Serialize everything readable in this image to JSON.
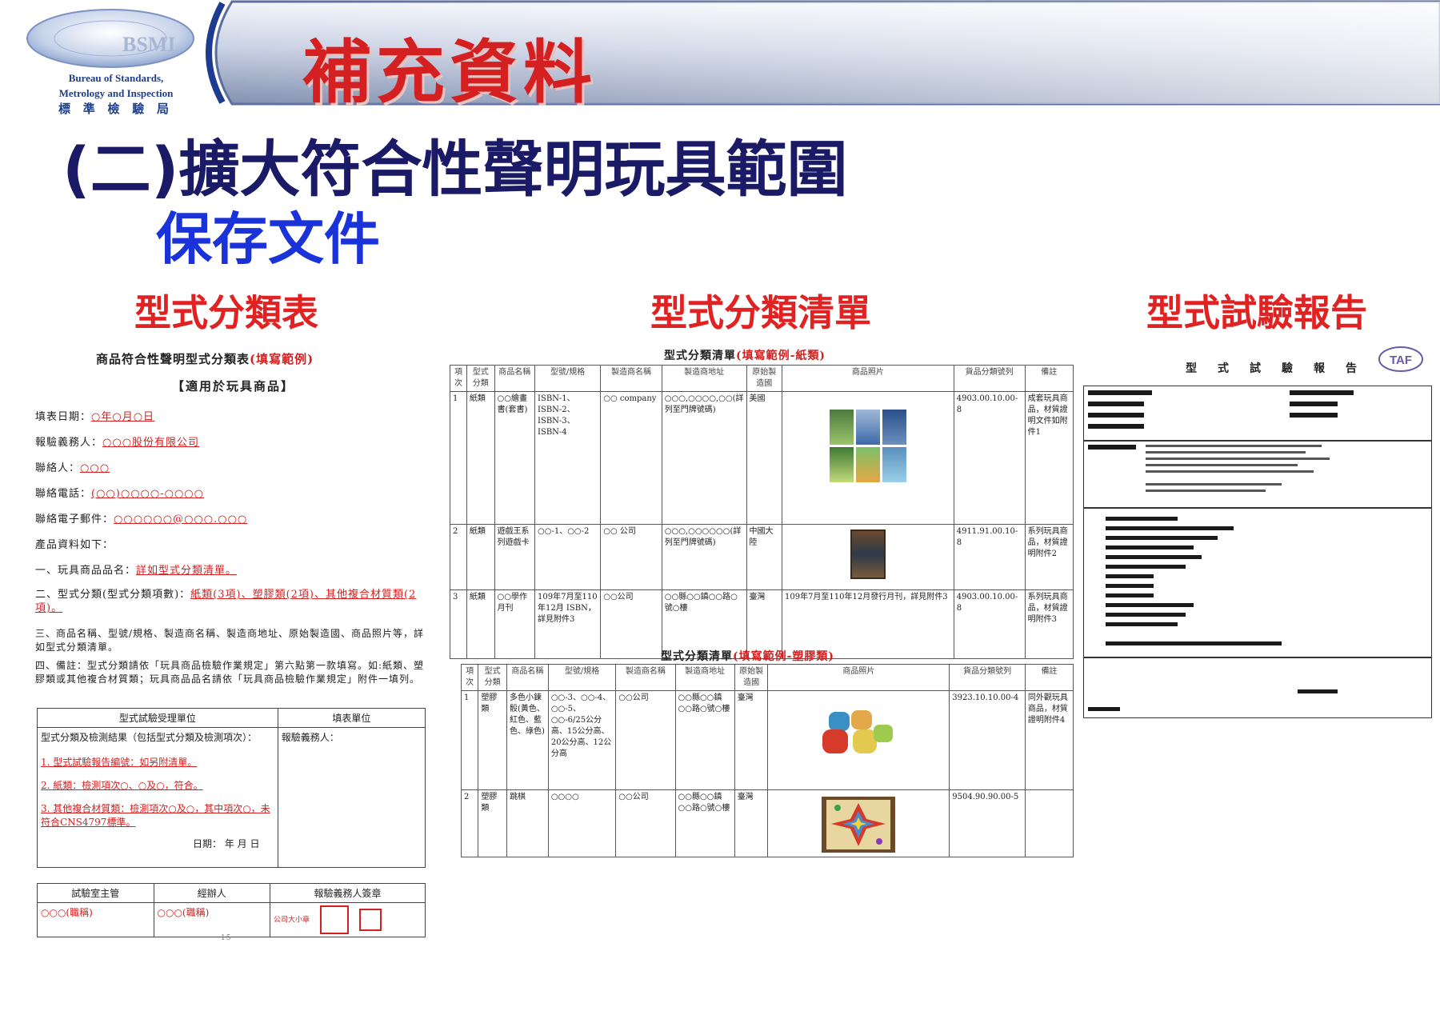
{
  "logo": {
    "abbr": "BSMI",
    "line1": "Bureau of Standards,",
    "line2": "Metrology and Inspection",
    "line3": "標 準 檢 驗 局"
  },
  "banner": {
    "title": "補充資料"
  },
  "heading": "(二)擴大符合性聲明玩具範圍",
  "subheading": "保存文件",
  "sections": {
    "a": "型式分類表",
    "b": "型式分類清單",
    "c": "型式試驗報告"
  },
  "doc1": {
    "title": "商品符合性聲明型式分類表",
    "title_note": "(填寫範例)",
    "subtitle": "【適用於玩具商品】",
    "lines": [
      {
        "label": "填表日期：",
        "value": "○年○月○日"
      },
      {
        "label": "報驗義務人：",
        "value": "○○○股份有限公司"
      },
      {
        "label": "聯絡人：",
        "value": "○○○"
      },
      {
        "label": "聯絡電話：",
        "value": "(○○)○○○○-○○○○"
      },
      {
        "label": "聯絡電子郵件：",
        "value": "○○○○○○@○○○.○○○"
      },
      {
        "label": "產品資料如下：",
        "value": ""
      },
      {
        "label": "一、玩具商品品名：",
        "value": "詳如型式分類清單。"
      },
      {
        "label": "二、型式分類(型式分類項數)：",
        "value": "紙類(3項)、塑膠類(2項)、其他複合材質類(2項)。"
      },
      {
        "label": "三、商品名稱、型號/規格、製造商名稱、製造商地址、原始製造國、商品照片等，詳如型式分類清單。",
        "value": ""
      },
      {
        "label": "四、備註：型式分類請依「玩具商品檢驗作業規定」第六點第一款填寫。如:紙類、塑膠類或其他複合材質類；玩具商品品名請依「玩具商品檢驗作業規定」附件一填列。",
        "value": ""
      }
    ],
    "table": {
      "h1": "型式試驗受理單位",
      "h2": "填表單位",
      "r1c1": "型式分類及檢測結果（包括型式分類及檢測項次）：",
      "r1c2": "報驗義務人：",
      "results": [
        "1. 型式試驗報告編號：如另附清單。",
        "2. 紙類：檢測項次○、○及○，符合。",
        "3. 其他複合材質類：檢測項次○及○，其中項次○，未符合CNS4797標準。"
      ],
      "date": "日期： 年 月 日",
      "f1": "試驗室主管",
      "f2": "經辦人",
      "f3": "報驗義務人簽章",
      "v1": "○○○(職稱)",
      "v2": "○○○(職稱)",
      "v3": "公司大小章"
    },
    "page": "15"
  },
  "doc2": {
    "paper_title": "型式分類清單",
    "paper_note": "(填寫範例-紙類)",
    "plastic_title": "型式分類清單",
    "plastic_note": "(填寫範例-塑膠類)",
    "headers": [
      "項次",
      "型式分類",
      "商品名稱",
      "型號/規格",
      "製造商名稱",
      "製造商地址",
      "原始製造國",
      "商品照片",
      "貨品分類號列",
      "備註"
    ],
    "paper_rows": [
      [
        "1",
        "紙類",
        "○○繪畫書(套書)",
        "ISBN-1、ISBN-2、ISBN-3、ISBN-4",
        "○○ company",
        "○○○,○○○○,○○(詳列至門牌號碼)",
        "美國",
        "",
        "4903.00.10.00-8",
        "成套玩具商品，材質證明文件如附件1"
      ],
      [
        "2",
        "紙類",
        "遊戲王系列遊戲卡",
        "○○-1、○○-2",
        "○○ 公司",
        "○○○,○○○○○○(詳列至門牌號碼)",
        "中國大陸",
        "",
        "4911.91.00.10-8",
        "系列玩具商品，材質證明附件2"
      ],
      [
        "3",
        "紙類",
        "○○學作月刊",
        "109年7月至110年12月 ISBN，詳見附件3",
        "○○公司",
        "○○縣○○鎮○○路○號○樓",
        "臺灣",
        "109年7月至110年12月發行月刊，詳見附件3",
        "4903.00.10.00-8",
        "系列玩具商品，材質證明附件3"
      ]
    ],
    "plastic_rows": [
      [
        "1",
        "塑膠類",
        "多色小鍊骰(黃色、紅色、藍色、綠色)",
        "○○-3、○○-4、○○-5、○○-6/25公分高、15公分高、20公分高、12公分高",
        "○○公司",
        "○○縣○○鎮○○路○號○樓",
        "臺灣",
        "",
        "3923.10.10.00-4",
        "同外觀玩具商品，材質證明附件4"
      ],
      [
        "2",
        "塑膠類",
        "跳棋",
        "○○○○",
        "○○公司",
        "○○縣○○鎮○○路○號○樓",
        "臺灣",
        "",
        "9504.90.90.00-5",
        ""
      ]
    ]
  },
  "doc3": {
    "title": "型式試驗報告",
    "badge": "TAF"
  },
  "colors": {
    "banner_red": "#d42020",
    "heading_navy": "#1a1a66",
    "subheading_blue": "#1a33d9",
    "section_red": "#e02222"
  }
}
